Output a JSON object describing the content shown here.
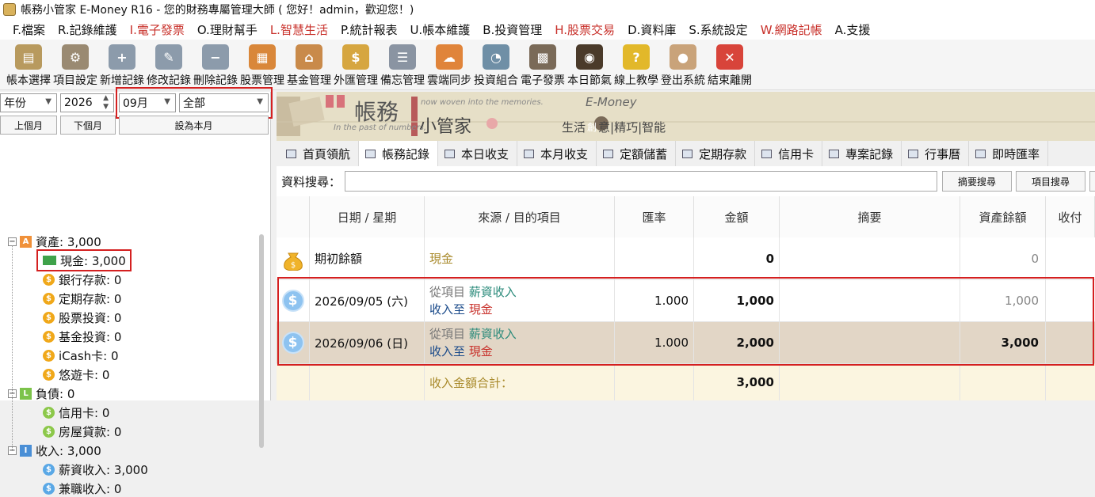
{
  "window": {
    "title": "帳務小管家 E-Money R16 - 您的財務專屬管理大師 ( 您好！admin，歡迎您！)"
  },
  "menu": [
    {
      "label": "F.檔案",
      "red": false
    },
    {
      "label": "R.記錄維護",
      "red": false
    },
    {
      "label": "I.電子發票",
      "red": true
    },
    {
      "label": "O.理財幫手",
      "red": false
    },
    {
      "label": "L.智慧生活",
      "red": true
    },
    {
      "label": "P.統計報表",
      "red": false
    },
    {
      "label": "U.帳本維護",
      "red": false
    },
    {
      "label": "B.投資管理",
      "red": false
    },
    {
      "label": "H.股票交易",
      "red": true
    },
    {
      "label": "D.資料庫",
      "red": false
    },
    {
      "label": "S.系統設定",
      "red": false
    },
    {
      "label": "W.網路記帳",
      "red": true
    },
    {
      "label": "A.支援",
      "red": false
    }
  ],
  "toolbar": [
    {
      "label": "帳本選擇",
      "icon": "ledger-icon",
      "color": "#b89a5e",
      "glyph": "▤"
    },
    {
      "label": "項目設定",
      "icon": "settings-icon",
      "color": "#9a8a72",
      "glyph": "⚙"
    },
    {
      "label": "新增記錄",
      "icon": "add-record-icon",
      "color": "#8c9bab",
      "glyph": "+"
    },
    {
      "label": "修改記錄",
      "icon": "edit-record-icon",
      "color": "#8c9bab",
      "glyph": "✎"
    },
    {
      "label": "刪除記錄",
      "icon": "delete-record-icon",
      "color": "#8c9bab",
      "glyph": "−"
    },
    {
      "label": "股票管理",
      "icon": "stock-icon",
      "color": "#d9873a",
      "glyph": "▦"
    },
    {
      "label": "基金管理",
      "icon": "fund-icon",
      "color": "#c98a4a",
      "glyph": "⌂"
    },
    {
      "label": "外匯管理",
      "icon": "forex-icon",
      "color": "#d6a640",
      "glyph": "$"
    },
    {
      "label": "備忘管理",
      "icon": "memo-icon",
      "color": "#8a94a2",
      "glyph": "☰"
    },
    {
      "label": "雲端同步",
      "icon": "cloud-sync-icon",
      "color": "#e0843a",
      "glyph": "☁"
    },
    {
      "label": "投資組合",
      "icon": "portfolio-icon",
      "color": "#6f8fa6",
      "glyph": "◔"
    },
    {
      "label": "電子發票",
      "icon": "qr-invoice-icon",
      "color": "#7a6a58",
      "glyph": "▩"
    },
    {
      "label": "本日節氣",
      "icon": "solar-term-icon",
      "color": "#4a3a2a",
      "glyph": "◉"
    },
    {
      "label": "線上教學",
      "icon": "help-icon",
      "color": "#e2b82a",
      "glyph": "?"
    },
    {
      "label": "登出系統",
      "icon": "logout-icon",
      "color": "#c9a37a",
      "glyph": "●"
    },
    {
      "label": "結束離開",
      "icon": "exit-icon",
      "color": "#d8443a",
      "glyph": "✕"
    }
  ],
  "filters": {
    "period_type": "年份",
    "year": "2026",
    "month": "09月",
    "scope": "全部",
    "prev_month": "上個月",
    "next_month": "下個月",
    "this_month": "設為本月"
  },
  "tree": [
    {
      "label": "資產: 3,000",
      "level": 0,
      "badge": "A",
      "color": "#f0913a",
      "selected": false
    },
    {
      "label": "現金: 3,000",
      "level": 1,
      "badge": "cash",
      "color": "#3fa24a",
      "selected": true
    },
    {
      "label": "銀行存款: 0",
      "level": 1,
      "badge": "$",
      "color": "#f0a81a",
      "selected": false
    },
    {
      "label": "定期存款: 0",
      "level": 1,
      "badge": "$",
      "color": "#f0a81a",
      "selected": false
    },
    {
      "label": "股票投資: 0",
      "level": 1,
      "badge": "$",
      "color": "#f0a81a",
      "selected": false
    },
    {
      "label": "基金投資: 0",
      "level": 1,
      "badge": "$",
      "color": "#f0a81a",
      "selected": false
    },
    {
      "label": "iCash卡: 0",
      "level": 1,
      "badge": "$",
      "color": "#f0a81a",
      "selected": false
    },
    {
      "label": "悠遊卡: 0",
      "level": 1,
      "badge": "$",
      "color": "#f0a81a",
      "selected": false
    },
    {
      "label": "負債: 0",
      "level": 0,
      "badge": "L",
      "color": "#7cc34a",
      "selected": false
    },
    {
      "label": "信用卡: 0",
      "level": 1,
      "badge": "$",
      "color": "#8cc84a",
      "selected": false
    },
    {
      "label": "房屋貸款: 0",
      "level": 1,
      "badge": "$",
      "color": "#8cc84a",
      "selected": false
    },
    {
      "label": "收入: 3,000",
      "level": 0,
      "badge": "I",
      "color": "#4a8fd6",
      "selected": false
    },
    {
      "label": "薪資收入: 3,000",
      "level": 1,
      "badge": "$",
      "color": "#5aa8e6",
      "selected": false
    },
    {
      "label": "兼職收入: 0",
      "level": 1,
      "badge": "$",
      "color": "#5aa8e6",
      "selected": false
    }
  ],
  "banner": {
    "title_1": "帳務",
    "title_2": "小管家",
    "tagline_1": "now woven into the memories.",
    "tagline_2": "In the past of numbers,",
    "brand": "E-Money",
    "slogan": "生活",
    "slogan_mid": "創",
    "slogan_end": "意|精巧|智能"
  },
  "tabs": [
    {
      "label": "首頁領航",
      "active": false
    },
    {
      "label": "帳務記錄",
      "active": true
    },
    {
      "label": "本日收支",
      "active": false
    },
    {
      "label": "本月收支",
      "active": false
    },
    {
      "label": "定額儲蓄",
      "active": false
    },
    {
      "label": "定期存款",
      "active": false
    },
    {
      "label": "信用卡",
      "active": false
    },
    {
      "label": "專案記錄",
      "active": false
    },
    {
      "label": "行事曆",
      "active": false
    },
    {
      "label": "即時匯率",
      "active": false
    }
  ],
  "search": {
    "label": "資料搜尋：",
    "value": "",
    "btn_summary": "摘要搜尋",
    "btn_item": "項目搜尋"
  },
  "columns": [
    "日期 / 星期",
    "來源 / 目的項目",
    "匯率",
    "金額",
    "摘要",
    "資產餘額",
    "收付"
  ],
  "opening": {
    "label": "期初餘額",
    "item": "現金",
    "amount": "0",
    "balance": "0"
  },
  "records": [
    {
      "date": "2026/09/05 (六)",
      "from_prefix": "從項目",
      "from": "薪資收入",
      "to_prefix": "收入至",
      "to": "現金",
      "rate": "1.000",
      "amount": "1,000",
      "summary": "",
      "balance": "1,000"
    },
    {
      "date": "2026/09/06 (日)",
      "from_prefix": "從項目",
      "from": "薪資收入",
      "to_prefix": "收入至",
      "to": "現金",
      "rate": "1.000",
      "amount": "2,000",
      "summary": "",
      "balance": "3,000"
    }
  ],
  "total": {
    "label": "收入金額合計：",
    "amount": "3,000"
  }
}
